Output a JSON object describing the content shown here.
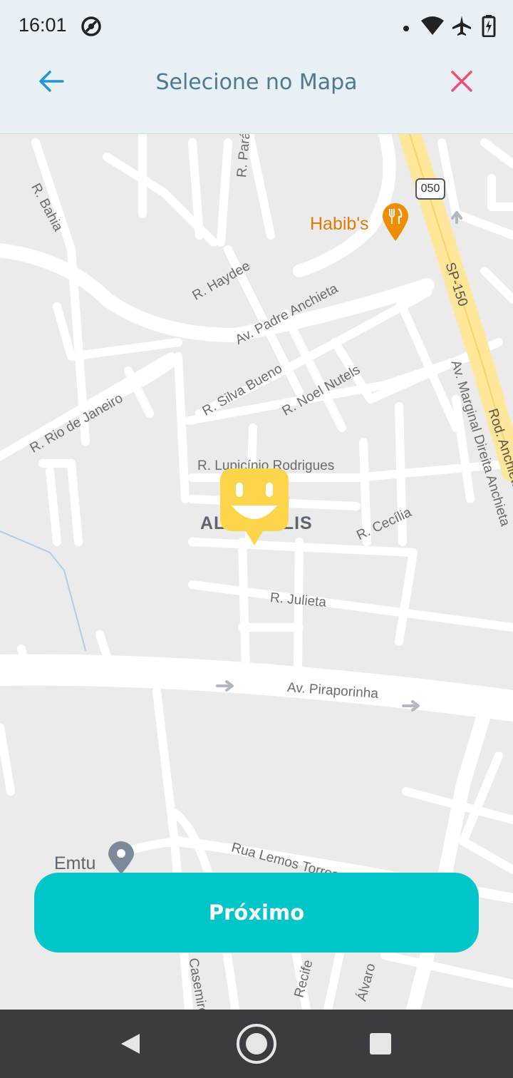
{
  "status_bar": {
    "time": "16:01",
    "icons": [
      "no-disturb-icon",
      "dot-icon",
      "wifi-icon",
      "airplane-icon",
      "battery-charging-icon"
    ]
  },
  "header": {
    "title": "Selecione no Mapa",
    "back_icon": "arrow-left-icon",
    "close_icon": "close-icon",
    "accent_color": "#2196d6",
    "close_color": "#ef4f7a"
  },
  "map": {
    "district": "ALTO POLIS",
    "route_shield": "050",
    "streets": [
      "R. Bahia",
      "R. Pará",
      "R. Haydee",
      "Av. Padre Anchieta",
      "R. Silva Bueno",
      "R. Noel Nutels",
      "R. Rio de Janeiro",
      "R. Lupicínio Rodrigues",
      "R. Cecília",
      "R. Julieta",
      "Av. Piraporinha",
      "Rua Lemos Torres",
      "SP-150",
      "Rod. Anchieta",
      "Av. Marginal Direita Anchieta",
      "Recife",
      "Casemiro",
      "Álvaro"
    ],
    "pois": [
      {
        "name": "Habib's",
        "icon": "restaurant-icon",
        "color": "#e07b06"
      },
      {
        "name": "Emtu",
        "icon": "location-pin-icon",
        "color": "#5d6670"
      }
    ],
    "marker_icon": "smiley-marker-icon",
    "marker_color": "#fdd54a"
  },
  "actions": {
    "next_label": "Próximo",
    "next_color": "#00c5c9"
  },
  "nav_bar": {
    "back_icon": "nav-back-icon",
    "home_icon": "nav-home-icon",
    "recents_icon": "nav-recents-icon"
  }
}
